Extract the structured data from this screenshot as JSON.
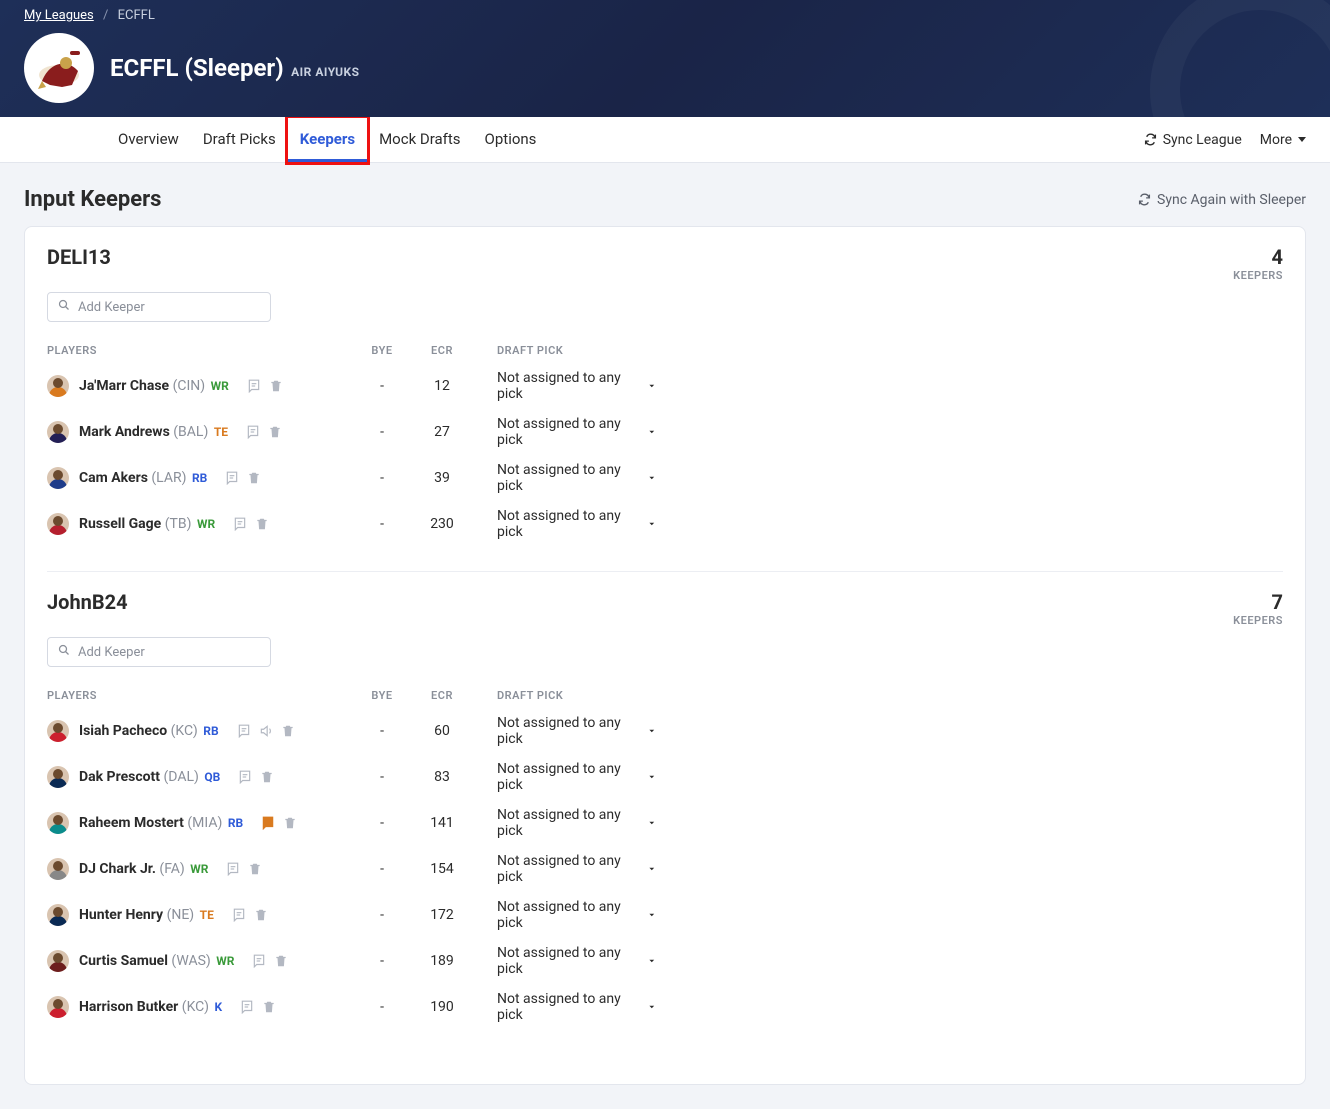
{
  "breadcrumb": {
    "parent": "My Leagues",
    "current": "ECFFL"
  },
  "league": {
    "title": "ECFFL (Sleeper)",
    "subtitle": "AIR AIYUKS"
  },
  "tabs": {
    "overview": "Overview",
    "draft_picks": "Draft Picks",
    "keepers": "Keepers",
    "mock_drafts": "Mock Drafts",
    "options": "Options"
  },
  "tabbar_right": {
    "sync": "Sync League",
    "more": "More"
  },
  "page": {
    "title": "Input Keepers",
    "sync_again": "Sync Again with Sleeper",
    "add_keeper_placeholder": "Add Keeper"
  },
  "columns": {
    "players": "PLAYERS",
    "bye": "BYE",
    "ecr": "ECR",
    "draft_pick": "DRAFT PICK"
  },
  "keepers_label": "KEEPERS",
  "pick_default": "Not assigned to any pick",
  "teams": [
    {
      "name": "DELI13",
      "count": "4",
      "players": [
        {
          "name": "Ja'Marr Chase",
          "team": "(CIN)",
          "pos": "WR",
          "bye": "-",
          "ecr": "12",
          "torso": "#d97a1f",
          "note_flag": false,
          "sound": false
        },
        {
          "name": "Mark Andrews",
          "team": "(BAL)",
          "pos": "TE",
          "bye": "-",
          "ecr": "27",
          "torso": "#231f56",
          "note_flag": false,
          "sound": false
        },
        {
          "name": "Cam Akers",
          "team": "(LAR)",
          "pos": "RB",
          "bye": "-",
          "ecr": "39",
          "torso": "#1e3c8a",
          "note_flag": false,
          "sound": false
        },
        {
          "name": "Russell Gage",
          "team": "(TB)",
          "pos": "WR",
          "bye": "-",
          "ecr": "230",
          "torso": "#b51f2e",
          "note_flag": false,
          "sound": false
        }
      ]
    },
    {
      "name": "JohnB24",
      "count": "7",
      "players": [
        {
          "name": "Isiah Pacheco",
          "team": "(KC)",
          "pos": "RB",
          "bye": "-",
          "ecr": "60",
          "torso": "#cc1f2e",
          "note_flag": false,
          "sound": true
        },
        {
          "name": "Dak Prescott",
          "team": "(DAL)",
          "pos": "QB",
          "bye": "-",
          "ecr": "83",
          "torso": "#0a2a54",
          "note_flag": false,
          "sound": false
        },
        {
          "name": "Raheem Mostert",
          "team": "(MIA)",
          "pos": "RB",
          "bye": "-",
          "ecr": "141",
          "torso": "#0b8c8c",
          "note_flag": true,
          "sound": false
        },
        {
          "name": "DJ Chark Jr.",
          "team": "(FA)",
          "pos": "WR",
          "bye": "-",
          "ecr": "154",
          "torso": "#888888",
          "note_flag": false,
          "sound": false
        },
        {
          "name": "Hunter Henry",
          "team": "(NE)",
          "pos": "TE",
          "bye": "-",
          "ecr": "172",
          "torso": "#0a2a54",
          "note_flag": false,
          "sound": false
        },
        {
          "name": "Curtis Samuel",
          "team": "(WAS)",
          "pos": "WR",
          "bye": "-",
          "ecr": "189",
          "torso": "#6d1d1d",
          "note_flag": false,
          "sound": false
        },
        {
          "name": "Harrison Butker",
          "team": "(KC)",
          "pos": "K",
          "bye": "-",
          "ecr": "190",
          "torso": "#cc1f2e",
          "note_flag": false,
          "sound": false
        }
      ]
    }
  ]
}
